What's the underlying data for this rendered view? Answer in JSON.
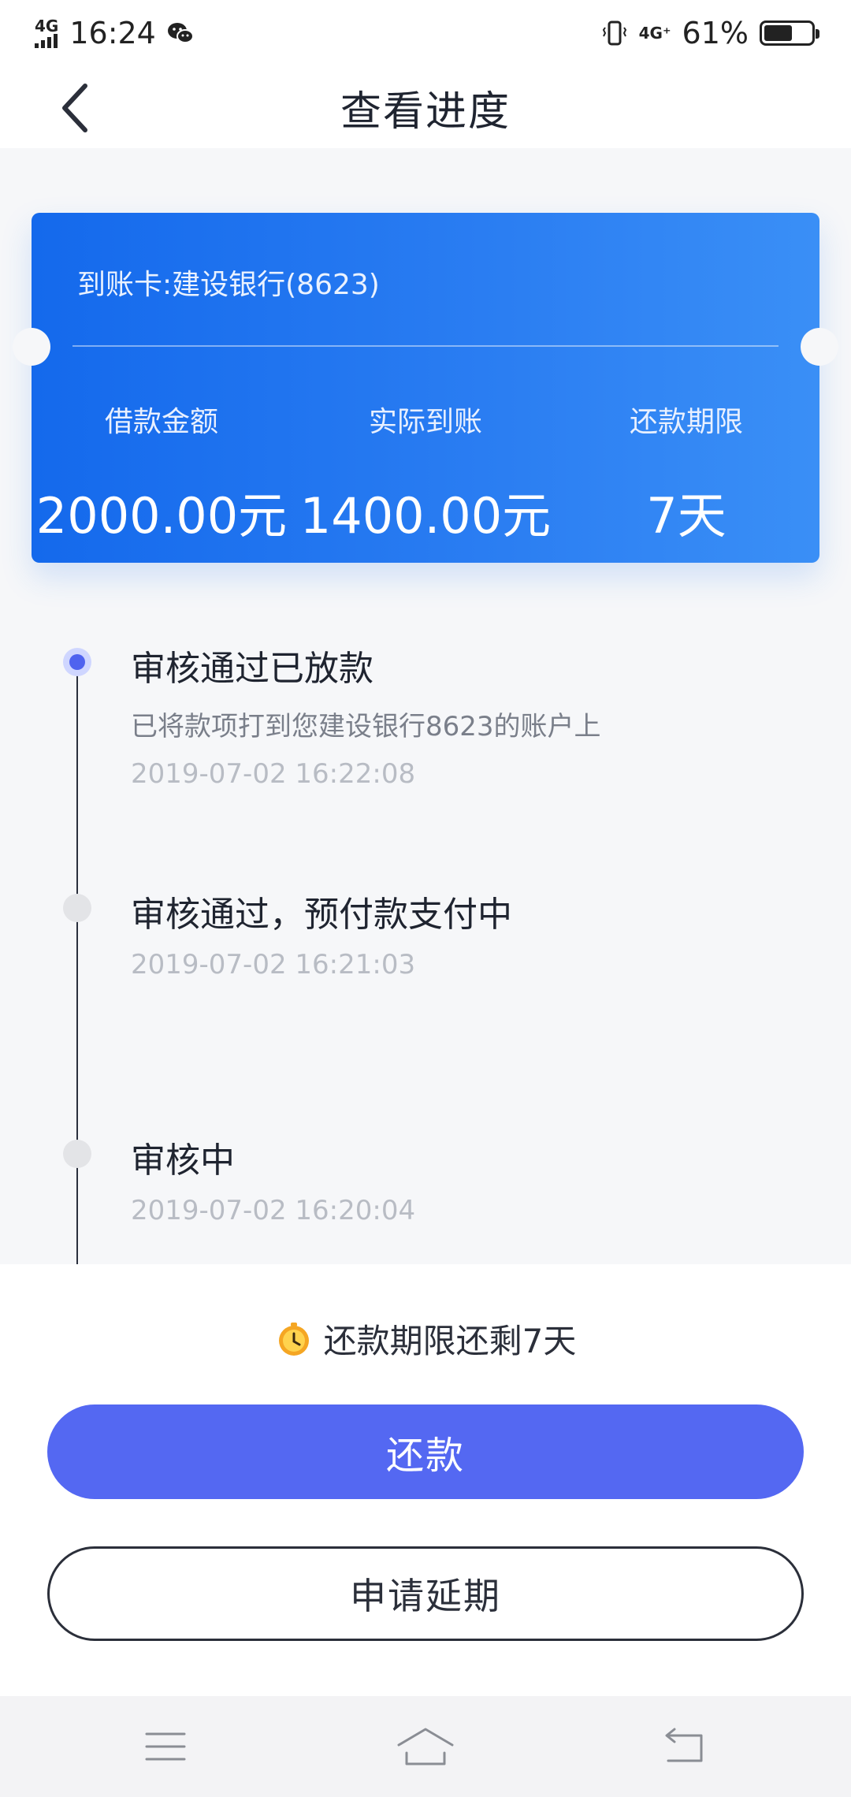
{
  "status_bar": {
    "network_left": "4G",
    "time": "16:24",
    "network_right": "4G⁺",
    "battery_percent": "61%",
    "battery_level": 0.61
  },
  "nav": {
    "title": "查看进度"
  },
  "card": {
    "account": "到账卡:建设银行(8623)",
    "stats": [
      {
        "label": "借款金额",
        "value": "2000.00元"
      },
      {
        "label": "实际到账",
        "value": "1400.00元"
      },
      {
        "label": "还款期限",
        "value": "7天"
      }
    ],
    "gradient_start": "#1469ec",
    "gradient_end": "#3a8ff6"
  },
  "timeline": [
    {
      "title": "审核通过已放款",
      "desc": "已将款项打到您建设银行8623的账户上",
      "time": "2019-07-02 16:22:08",
      "active": true
    },
    {
      "title": "审核通过，预付款支付中",
      "desc": "",
      "time": "2019-07-02 16:21:03",
      "active": false
    },
    {
      "title": "审核中",
      "desc": "",
      "time": "2019-07-02 16:20:04",
      "active": false
    }
  ],
  "bottom": {
    "remaining_text": "还款期限还剩7天",
    "repay_label": "还款",
    "extend_label": "申请延期",
    "accent": "#5468f2"
  },
  "icons": {
    "back": "chevron-left-icon",
    "clock": "clock-icon",
    "menu": "menu-icon",
    "home": "home-icon",
    "return": "back-arrow-icon"
  }
}
